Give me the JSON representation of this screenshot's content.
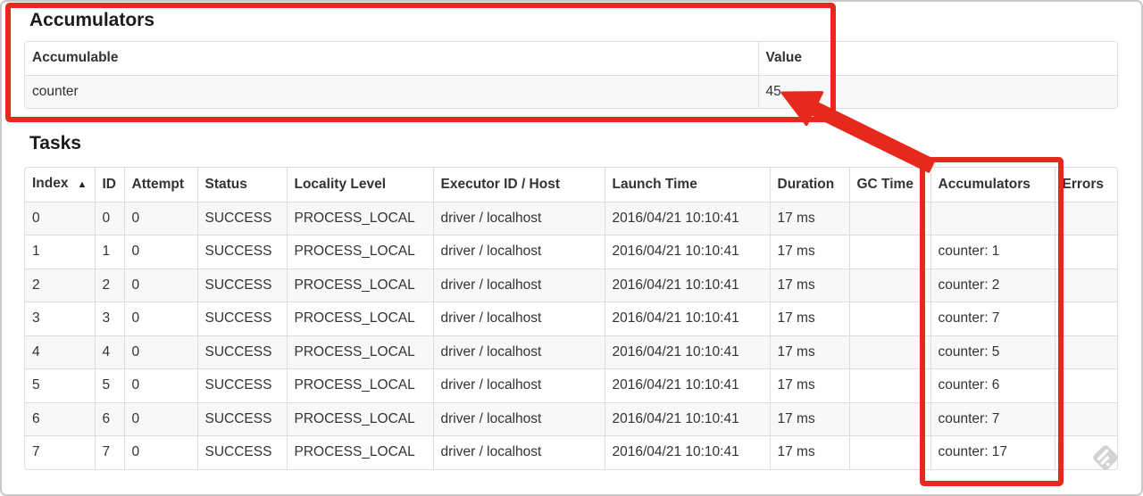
{
  "accumulators": {
    "title": "Accumulators",
    "columns": [
      "Accumulable",
      "Value"
    ],
    "rows": [
      [
        "counter",
        "45"
      ]
    ]
  },
  "tasks": {
    "title": "Tasks",
    "sort_indicator": "▲",
    "columns": [
      "Index",
      "ID",
      "Attempt",
      "Status",
      "Locality Level",
      "Executor ID / Host",
      "Launch Time",
      "Duration",
      "GC Time",
      "Accumulators",
      "Errors"
    ],
    "rows": [
      [
        "0",
        "0",
        "0",
        "SUCCESS",
        "PROCESS_LOCAL",
        "driver / localhost",
        "2016/04/21 10:10:41",
        "17 ms",
        "",
        "",
        ""
      ],
      [
        "1",
        "1",
        "0",
        "SUCCESS",
        "PROCESS_LOCAL",
        "driver / localhost",
        "2016/04/21 10:10:41",
        "17 ms",
        "",
        "counter: 1",
        ""
      ],
      [
        "2",
        "2",
        "0",
        "SUCCESS",
        "PROCESS_LOCAL",
        "driver / localhost",
        "2016/04/21 10:10:41",
        "17 ms",
        "",
        "counter: 2",
        ""
      ],
      [
        "3",
        "3",
        "0",
        "SUCCESS",
        "PROCESS_LOCAL",
        "driver / localhost",
        "2016/04/21 10:10:41",
        "17 ms",
        "",
        "counter: 7",
        ""
      ],
      [
        "4",
        "4",
        "0",
        "SUCCESS",
        "PROCESS_LOCAL",
        "driver / localhost",
        "2016/04/21 10:10:41",
        "17 ms",
        "",
        "counter: 5",
        ""
      ],
      [
        "5",
        "5",
        "0",
        "SUCCESS",
        "PROCESS_LOCAL",
        "driver / localhost",
        "2016/04/21 10:10:41",
        "17 ms",
        "",
        "counter: 6",
        ""
      ],
      [
        "6",
        "6",
        "0",
        "SUCCESS",
        "PROCESS_LOCAL",
        "driver / localhost",
        "2016/04/21 10:10:41",
        "17 ms",
        "",
        "counter: 7",
        ""
      ],
      [
        "7",
        "7",
        "0",
        "SUCCESS",
        "PROCESS_LOCAL",
        "driver / localhost",
        "2016/04/21 10:10:41",
        "17 ms",
        "",
        "counter: 17",
        ""
      ]
    ]
  },
  "annotations": {
    "color": "#e7291d"
  },
  "watermark": {
    "color": "#d3d3d3",
    "stripe_color": "#ffffff"
  }
}
